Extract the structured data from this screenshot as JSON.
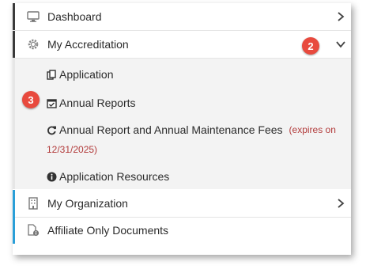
{
  "menu": {
    "dashboard": {
      "label": "Dashboard",
      "icon": "monitor-icon"
    },
    "my_accreditation": {
      "label": "My Accreditation",
      "icon": "gear-icon",
      "badge": "2",
      "submenu": {
        "application": {
          "label": "Application",
          "icon": "copy-icon"
        },
        "annual_reports": {
          "label": "Annual Reports",
          "icon": "calendar-check-icon",
          "badge": "3"
        },
        "annual_fees": {
          "label": "Annual Report and Annual Maintenance Fees",
          "expires_prefix": "(expires on",
          "expires_date": "12/31/2025)",
          "icon": "refresh-icon"
        },
        "resources": {
          "label": "Application Resources",
          "icon": "info-icon"
        }
      }
    },
    "my_organization": {
      "label": "My Organization",
      "icon": "building-icon"
    },
    "affiliate_docs": {
      "label": "Affiliate Only Documents",
      "icon": "document-info-icon"
    }
  },
  "colors": {
    "accent_dark": "#3a3a3a",
    "accent_blue": "#2a9fd8",
    "badge_red": "#e84a3e",
    "expires_red": "#b23b3b"
  }
}
